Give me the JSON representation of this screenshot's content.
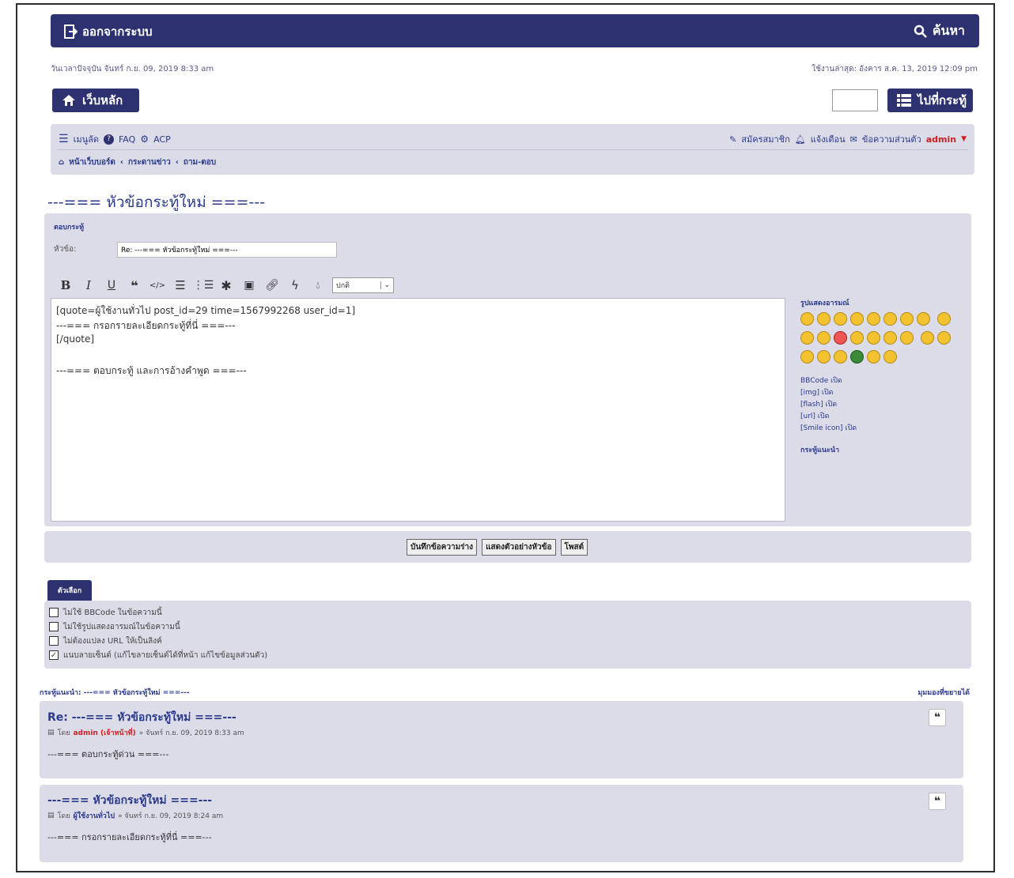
{
  "header": {
    "logout_label": "ออกจากระบบ",
    "search_label": "ค้นหา"
  },
  "timestamps": {
    "now_text": "วันเวลาปัจจุบัน จันทร์ ก.ย. 09, 2019 8:33 am",
    "last_visit_text": "ใช้งานล่าสุด: อังคาร ส.ค. 13, 2019 12:09 pm"
  },
  "home_button": "เว็บหลัก",
  "goto_button": "ไปที่กระทู้",
  "menu": {
    "quick_links": "เมนูลัด",
    "faq": "FAQ",
    "acp": "ACP",
    "register": "สมัครสมาชิก",
    "notifications": "แจ้งเตือน",
    "private_messages": "ข้อความส่วนตัว",
    "username": "admin"
  },
  "breadcrumb": {
    "home": "หน้าเว็บบอร์ด",
    "forum": "กระดานข่าว",
    "subforum": "ถาม-ตอบ"
  },
  "page_title": "---=== หัวข้อกระทู้ใหม่ ===---",
  "reply_form": {
    "section_label": "ตอบกระทู้",
    "subject_label": "หัวข้อ:",
    "subject_value": "Re: ---=== หัวข้อกระทู้ใหม่ ===---",
    "font_size_value": "ปกติ",
    "message_lines": [
      "[quote=ผู้ใช้งานทั่วไป post_id=29 time=1567992268 user_id=1]",
      "---=== กรอกรายละเอียดกระทู้ที่นี่ ===---",
      "[/quote]",
      "",
      " ---=== ตอบกระทู้ และการอ้างคำพูด ===---"
    ],
    "smilies_label": "รูปแสดงอารมณ์",
    "bbcode_status": [
      "BBCode เปิด",
      "[img] เปิด",
      "[flash] เปิด",
      "[url] เปิด",
      "[Smile icon] เปิด"
    ],
    "topic_review_link": "กระทู้แนะนำ"
  },
  "actions": {
    "save_draft": "บันทึกข้อความร่าง",
    "preview": "แสดงตัวอย่างหัวข้อ",
    "submit": "โพสต์"
  },
  "options": {
    "tab_label": "ตัวเลือก",
    "items": [
      {
        "label": "ไม่ใช้ BBCode ในข้อความนี้",
        "checked": false
      },
      {
        "label": "ไม่ใช้รูปแสดงอารมณ์ในข้อความนี้",
        "checked": false
      },
      {
        "label": "ไม่ต้องแปลง URL ให้เป็นลิงค์",
        "checked": false
      },
      {
        "label": "แนบลายเซ็นต์ (แก้ไขลายเซ็นต์ได้ที่หน้า แก้ไขข้อมูลส่วนตัว)",
        "checked": true
      }
    ]
  },
  "topic_review": {
    "heading": "กระทู้แนะนำ: ---=== หัวข้อกระทู้ใหม่ ===---",
    "expand_link": "มุมมองที่ขยายได้"
  },
  "posts": [
    {
      "title": "Re: ---=== หัวข้อกระทู้ใหม่ ===---",
      "by": "โดย",
      "author": "admin (เจ้าหน้าที่)",
      "date": "» จันทร์ ก.ย. 09, 2019 8:33 am",
      "body": "---=== ตอบกระทู้ด่วน ===---"
    },
    {
      "title": "---=== หัวข้อกระทู้ใหม่ ===---",
      "by": "โดย",
      "author": "ผู้ใช้งานทั่วไป",
      "date": "» จันทร์ ก.ย. 09, 2019 8:24 am",
      "body": "---=== กรอกรายละเอียดกระทู้ที่นี่ ===---"
    }
  ],
  "colors": {
    "navbar": "#2e3170",
    "panel": "#dcdbe8",
    "link": "#2a3a8c",
    "username": "#cc2222"
  }
}
